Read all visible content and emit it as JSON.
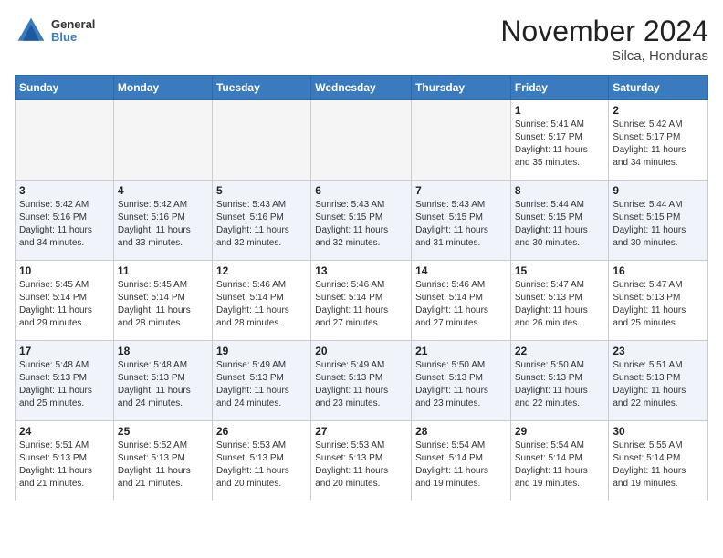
{
  "header": {
    "logo_general": "General",
    "logo_blue": "Blue",
    "month_title": "November 2024",
    "location": "Silca, Honduras"
  },
  "weekdays": [
    "Sunday",
    "Monday",
    "Tuesday",
    "Wednesday",
    "Thursday",
    "Friday",
    "Saturday"
  ],
  "weeks": [
    [
      {
        "day": "",
        "info": ""
      },
      {
        "day": "",
        "info": ""
      },
      {
        "day": "",
        "info": ""
      },
      {
        "day": "",
        "info": ""
      },
      {
        "day": "",
        "info": ""
      },
      {
        "day": "1",
        "info": "Sunrise: 5:41 AM\nSunset: 5:17 PM\nDaylight: 11 hours\nand 35 minutes."
      },
      {
        "day": "2",
        "info": "Sunrise: 5:42 AM\nSunset: 5:17 PM\nDaylight: 11 hours\nand 34 minutes."
      }
    ],
    [
      {
        "day": "3",
        "info": "Sunrise: 5:42 AM\nSunset: 5:16 PM\nDaylight: 11 hours\nand 34 minutes."
      },
      {
        "day": "4",
        "info": "Sunrise: 5:42 AM\nSunset: 5:16 PM\nDaylight: 11 hours\nand 33 minutes."
      },
      {
        "day": "5",
        "info": "Sunrise: 5:43 AM\nSunset: 5:16 PM\nDaylight: 11 hours\nand 32 minutes."
      },
      {
        "day": "6",
        "info": "Sunrise: 5:43 AM\nSunset: 5:15 PM\nDaylight: 11 hours\nand 32 minutes."
      },
      {
        "day": "7",
        "info": "Sunrise: 5:43 AM\nSunset: 5:15 PM\nDaylight: 11 hours\nand 31 minutes."
      },
      {
        "day": "8",
        "info": "Sunrise: 5:44 AM\nSunset: 5:15 PM\nDaylight: 11 hours\nand 30 minutes."
      },
      {
        "day": "9",
        "info": "Sunrise: 5:44 AM\nSunset: 5:15 PM\nDaylight: 11 hours\nand 30 minutes."
      }
    ],
    [
      {
        "day": "10",
        "info": "Sunrise: 5:45 AM\nSunset: 5:14 PM\nDaylight: 11 hours\nand 29 minutes."
      },
      {
        "day": "11",
        "info": "Sunrise: 5:45 AM\nSunset: 5:14 PM\nDaylight: 11 hours\nand 28 minutes."
      },
      {
        "day": "12",
        "info": "Sunrise: 5:46 AM\nSunset: 5:14 PM\nDaylight: 11 hours\nand 28 minutes."
      },
      {
        "day": "13",
        "info": "Sunrise: 5:46 AM\nSunset: 5:14 PM\nDaylight: 11 hours\nand 27 minutes."
      },
      {
        "day": "14",
        "info": "Sunrise: 5:46 AM\nSunset: 5:14 PM\nDaylight: 11 hours\nand 27 minutes."
      },
      {
        "day": "15",
        "info": "Sunrise: 5:47 AM\nSunset: 5:13 PM\nDaylight: 11 hours\nand 26 minutes."
      },
      {
        "day": "16",
        "info": "Sunrise: 5:47 AM\nSunset: 5:13 PM\nDaylight: 11 hours\nand 25 minutes."
      }
    ],
    [
      {
        "day": "17",
        "info": "Sunrise: 5:48 AM\nSunset: 5:13 PM\nDaylight: 11 hours\nand 25 minutes."
      },
      {
        "day": "18",
        "info": "Sunrise: 5:48 AM\nSunset: 5:13 PM\nDaylight: 11 hours\nand 24 minutes."
      },
      {
        "day": "19",
        "info": "Sunrise: 5:49 AM\nSunset: 5:13 PM\nDaylight: 11 hours\nand 24 minutes."
      },
      {
        "day": "20",
        "info": "Sunrise: 5:49 AM\nSunset: 5:13 PM\nDaylight: 11 hours\nand 23 minutes."
      },
      {
        "day": "21",
        "info": "Sunrise: 5:50 AM\nSunset: 5:13 PM\nDaylight: 11 hours\nand 23 minutes."
      },
      {
        "day": "22",
        "info": "Sunrise: 5:50 AM\nSunset: 5:13 PM\nDaylight: 11 hours\nand 22 minutes."
      },
      {
        "day": "23",
        "info": "Sunrise: 5:51 AM\nSunset: 5:13 PM\nDaylight: 11 hours\nand 22 minutes."
      }
    ],
    [
      {
        "day": "24",
        "info": "Sunrise: 5:51 AM\nSunset: 5:13 PM\nDaylight: 11 hours\nand 21 minutes."
      },
      {
        "day": "25",
        "info": "Sunrise: 5:52 AM\nSunset: 5:13 PM\nDaylight: 11 hours\nand 21 minutes."
      },
      {
        "day": "26",
        "info": "Sunrise: 5:53 AM\nSunset: 5:13 PM\nDaylight: 11 hours\nand 20 minutes."
      },
      {
        "day": "27",
        "info": "Sunrise: 5:53 AM\nSunset: 5:13 PM\nDaylight: 11 hours\nand 20 minutes."
      },
      {
        "day": "28",
        "info": "Sunrise: 5:54 AM\nSunset: 5:14 PM\nDaylight: 11 hours\nand 19 minutes."
      },
      {
        "day": "29",
        "info": "Sunrise: 5:54 AM\nSunset: 5:14 PM\nDaylight: 11 hours\nand 19 minutes."
      },
      {
        "day": "30",
        "info": "Sunrise: 5:55 AM\nSunset: 5:14 PM\nDaylight: 11 hours\nand 19 minutes."
      }
    ]
  ]
}
